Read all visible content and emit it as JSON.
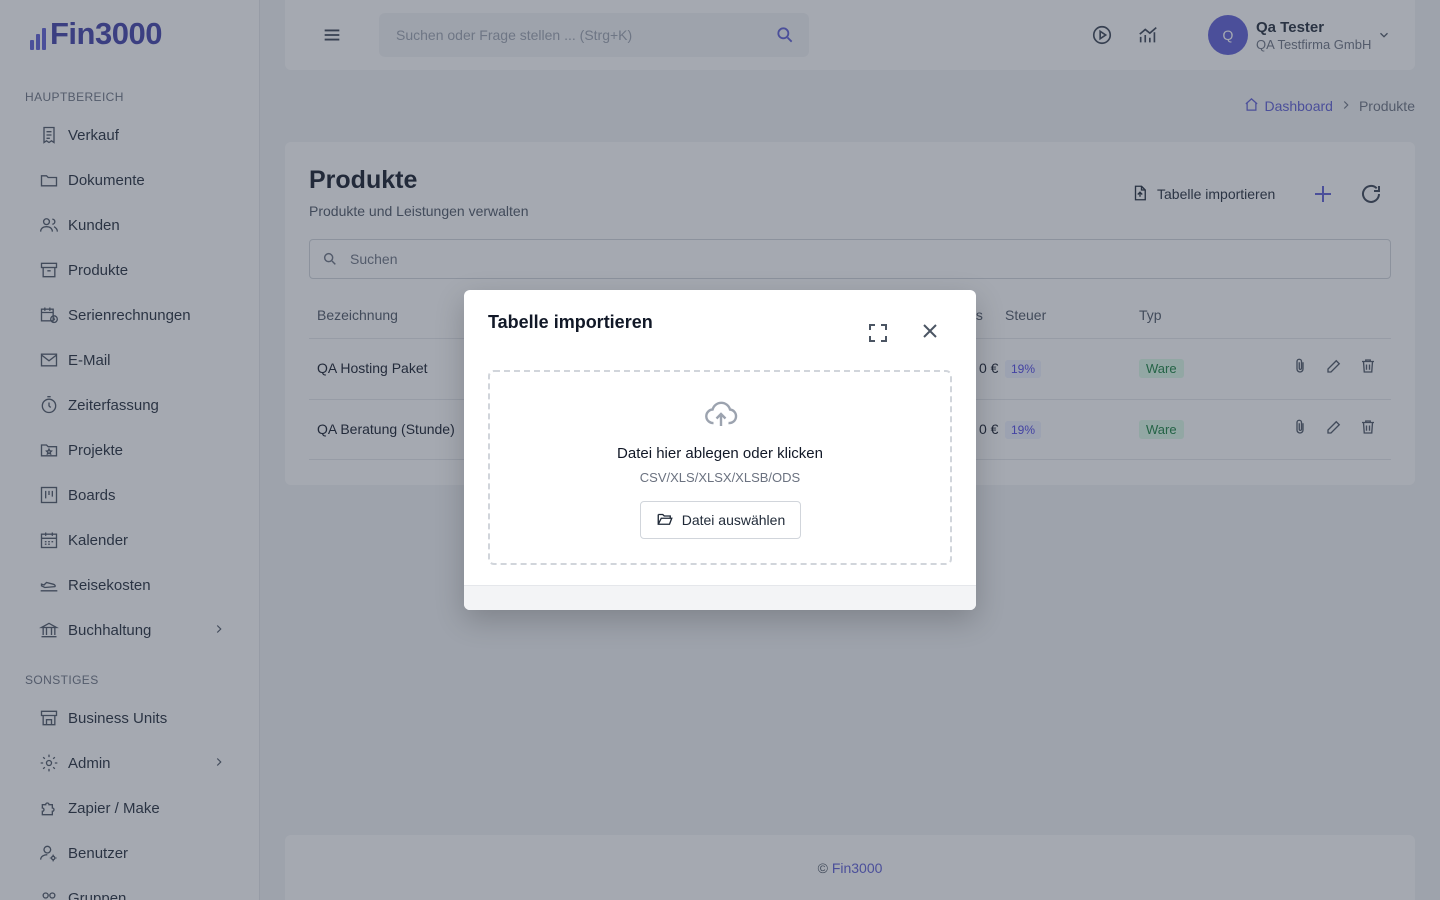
{
  "app": {
    "logo_text": "Fin3000"
  },
  "sidebar": {
    "section_main": "HAUPTBEREICH",
    "section_other": "SONSTIGES",
    "main_items": [
      {
        "label": "Verkauf",
        "icon": "receipt-icon"
      },
      {
        "label": "Dokumente",
        "icon": "folder-icon"
      },
      {
        "label": "Kunden",
        "icon": "users-icon"
      },
      {
        "label": "Produkte",
        "icon": "archive-icon"
      },
      {
        "label": "Serienrechnungen",
        "icon": "calendar-repeat-icon"
      },
      {
        "label": "E-Mail",
        "icon": "mail-icon"
      },
      {
        "label": "Zeiterfassung",
        "icon": "stopwatch-icon"
      },
      {
        "label": "Projekte",
        "icon": "folder-star-icon"
      },
      {
        "label": "Boards",
        "icon": "kanban-icon"
      },
      {
        "label": "Kalender",
        "icon": "calendar-icon"
      },
      {
        "label": "Reisekosten",
        "icon": "plane-icon"
      },
      {
        "label": "Buchhaltung",
        "icon": "bank-icon"
      }
    ],
    "other_items": [
      {
        "label": "Business Units",
        "icon": "store-icon"
      },
      {
        "label": "Admin",
        "icon": "gear-icon"
      },
      {
        "label": "Zapier / Make",
        "icon": "puzzle-icon"
      },
      {
        "label": "Benutzer",
        "icon": "user-cog-icon"
      },
      {
        "label": "Gruppen",
        "icon": "group-icon"
      }
    ]
  },
  "header": {
    "search_placeholder": "Suchen oder Frage stellen ... (Strg+K)",
    "user_initial": "Q",
    "user_name": "Qa Tester",
    "user_company": "QA Testfirma GmbH"
  },
  "breadcrumb": {
    "home": "Dashboard",
    "current": "Produkte"
  },
  "page": {
    "title": "Produkte",
    "subtitle": "Produkte und Leistungen verwalten",
    "import_label": "Tabelle importieren",
    "search_placeholder": "Suchen"
  },
  "table": {
    "columns": [
      "Bezeichnung",
      "eis",
      "Steuer",
      "Typ"
    ],
    "rows": [
      {
        "name": "QA Hosting Paket",
        "price_fragment": "0 €",
        "tax": "19%",
        "type": "Ware"
      },
      {
        "name": "QA Beratung (Stunde)",
        "price_fragment": "0 €",
        "tax": "19%",
        "type": "Ware"
      }
    ]
  },
  "footer": {
    "copyright": "©",
    "link": "Fin3000"
  },
  "modal": {
    "title": "Tabelle importieren",
    "drop_text": "Datei hier ablegen oder klicken",
    "formats": "CSV/XLS/XLSX/XLSB/ODS",
    "select_button": "Datei auswählen"
  },
  "colors": {
    "accent": "#5b5bd6",
    "overlay": "rgba(55,65,81,0.45)"
  }
}
